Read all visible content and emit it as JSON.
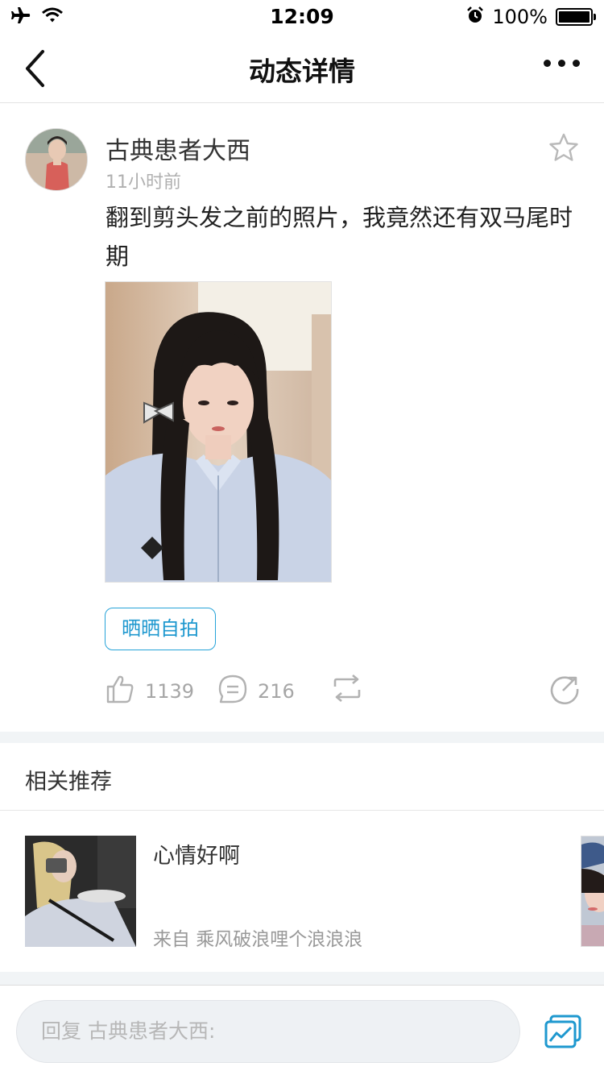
{
  "status_bar": {
    "time": "12:09",
    "battery_percent": "100%",
    "battery_level": 1.0,
    "icons": [
      "airplane-icon",
      "wifi-icon",
      "alarm-icon",
      "battery-icon"
    ]
  },
  "nav": {
    "title": "动态详情",
    "back_icon": "chevron-left-icon",
    "more_icon": "more-dots-icon"
  },
  "post": {
    "author": "古典患者大西",
    "time": "11小时前",
    "text": "翻到剪头发之前的照片，我竟然还有双马尾时期",
    "tag": "晒晒自拍",
    "likes": "1139",
    "comments": "216",
    "colors": {
      "tag": "#1e98cf",
      "icon_gray": "#a6a6a6"
    }
  },
  "recommend": {
    "header": "相关推荐",
    "items": [
      {
        "title": "心情好啊",
        "from": "来自 乘风破浪哩个浪浪浪"
      }
    ]
  },
  "reply": {
    "placeholder": "回复 古典患者大西:",
    "accent": "#1e98cf"
  }
}
